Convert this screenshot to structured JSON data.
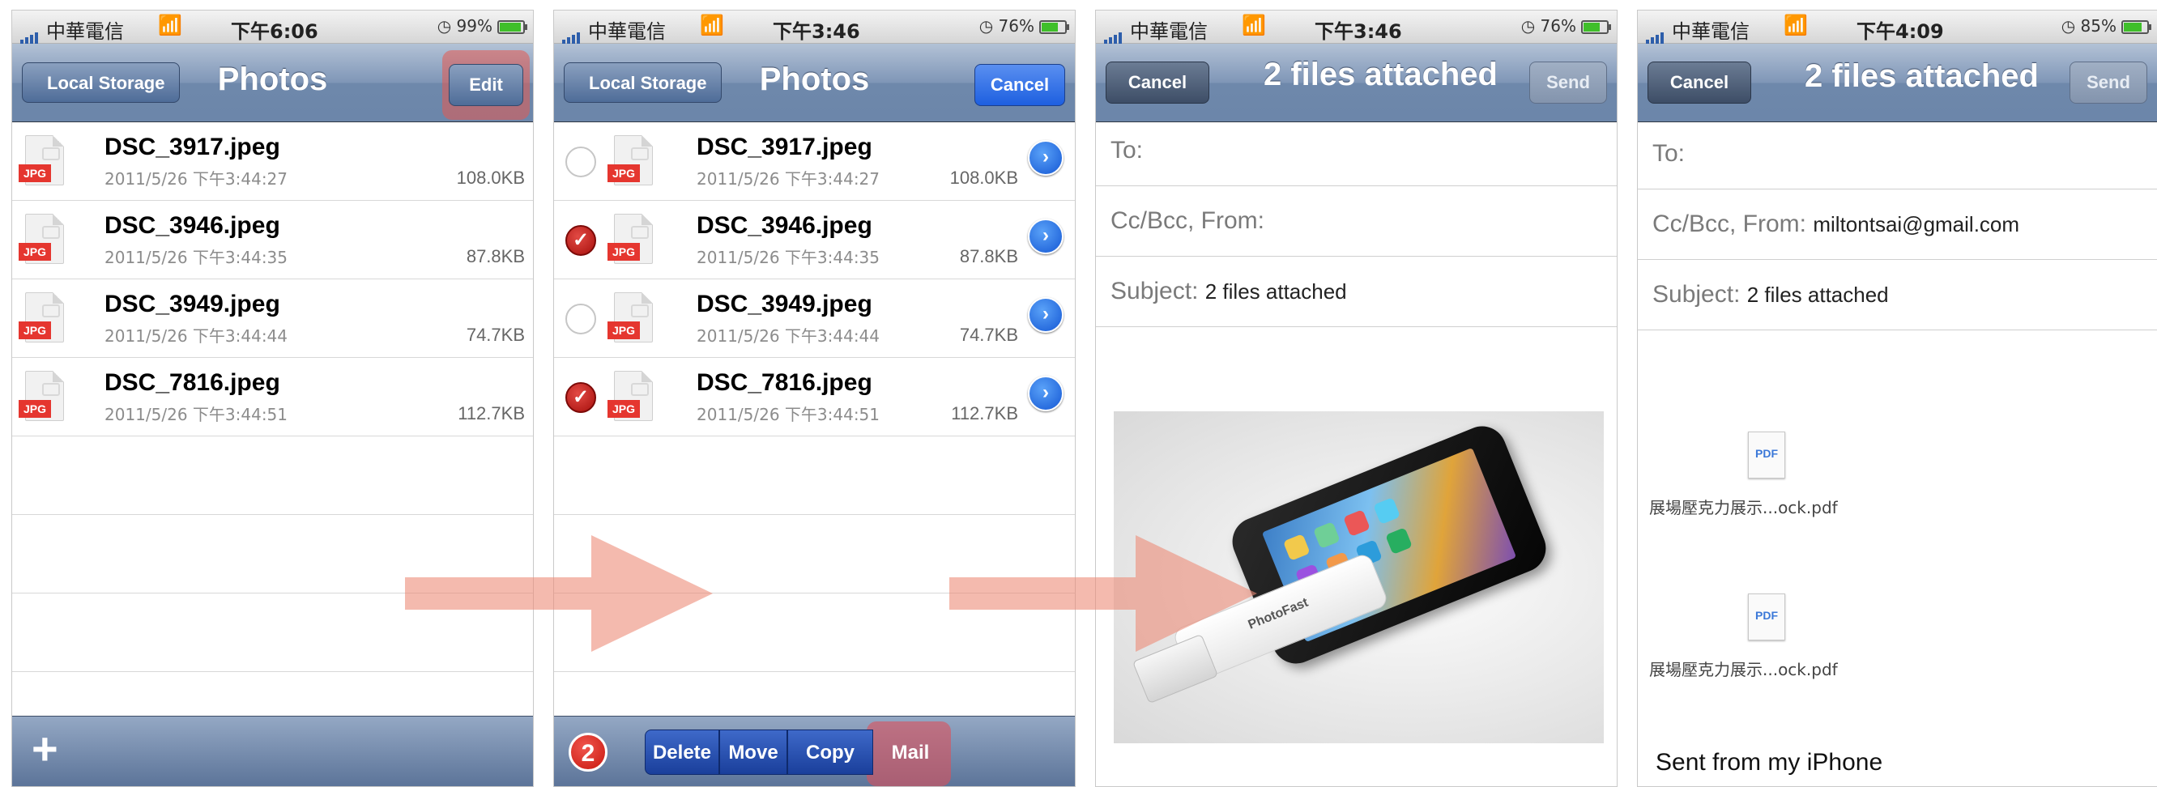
{
  "colors": {
    "arrow": "#ec8c78",
    "highlight": "#e65a50",
    "nav": "#6c86aa",
    "check_red": "#c21712",
    "disclosure_blue": "#1457d4"
  },
  "screens": [
    {
      "status": {
        "carrier": "中華電信",
        "time": "下午6:06",
        "battery": "99%",
        "battery_level": 0.99
      },
      "nav": {
        "back": "Local Storage",
        "title": "Photos",
        "right": "Edit"
      },
      "files": [
        {
          "name": "DSC_3917.jpeg",
          "date": "2011/5/26 下午3:44:27",
          "size": "108.0KB",
          "badge": "JPG"
        },
        {
          "name": "DSC_3946.jpeg",
          "date": "2011/5/26 下午3:44:35",
          "size": "87.8KB",
          "badge": "JPG"
        },
        {
          "name": "DSC_3949.jpeg",
          "date": "2011/5/26 下午3:44:44",
          "size": "74.7KB",
          "badge": "JPG"
        },
        {
          "name": "DSC_7816.jpeg",
          "date": "2011/5/26 下午3:44:51",
          "size": "112.7KB",
          "badge": "JPG"
        }
      ],
      "toolbar": {
        "add": "+"
      }
    },
    {
      "status": {
        "carrier": "中華電信",
        "time": "下午3:46",
        "battery": "76%",
        "battery_level": 0.76
      },
      "nav": {
        "back": "Local Storage",
        "title": "Photos",
        "right": "Cancel"
      },
      "files": [
        {
          "name": "DSC_3917.jpeg",
          "date": "2011/5/26 下午3:44:27",
          "size": "108.0KB",
          "badge": "JPG",
          "checked": false
        },
        {
          "name": "DSC_3946.jpeg",
          "date": "2011/5/26 下午3:44:35",
          "size": "87.8KB",
          "badge": "JPG",
          "checked": true
        },
        {
          "name": "DSC_3949.jpeg",
          "date": "2011/5/26 下午3:44:44",
          "size": "74.7KB",
          "badge": "JPG",
          "checked": false
        },
        {
          "name": "DSC_7816.jpeg",
          "date": "2011/5/26 下午3:44:51",
          "size": "112.7KB",
          "badge": "JPG",
          "checked": true
        }
      ],
      "toolbar": {
        "count": "2",
        "delete": "Delete",
        "move": "Move",
        "copy": "Copy",
        "mail": "Mail"
      }
    },
    {
      "status": {
        "carrier": "中華電信",
        "time": "下午3:46",
        "battery": "76%",
        "battery_level": 0.76
      },
      "nav": {
        "left": "Cancel",
        "title": "2 files attached",
        "right": "Send"
      },
      "fields": {
        "to_label": "To:",
        "ccbcc_label": "Cc/Bcc, From:",
        "subject_label": "Subject:",
        "subject_value": "2 files attached"
      },
      "photo_brand": "PhotoFast"
    },
    {
      "status": {
        "carrier": "中華電信",
        "time": "下午4:09",
        "battery": "85%",
        "battery_level": 0.85
      },
      "nav": {
        "left": "Cancel",
        "title": "2 files attached",
        "right": "Send"
      },
      "fields": {
        "to_label": "To:",
        "ccbcc_label": "Cc/Bcc, From:",
        "from_value": "miltontsai@gmail.com",
        "subject_label": "Subject:",
        "subject_value": "2 files attached"
      },
      "attachments": [
        {
          "icon": "PDF",
          "name": "展場壓克力展示...ock.pdf"
        },
        {
          "icon": "PDF",
          "name": "展場壓克力展示...ock.pdf"
        }
      ],
      "signature": "Sent from my iPhone"
    }
  ]
}
